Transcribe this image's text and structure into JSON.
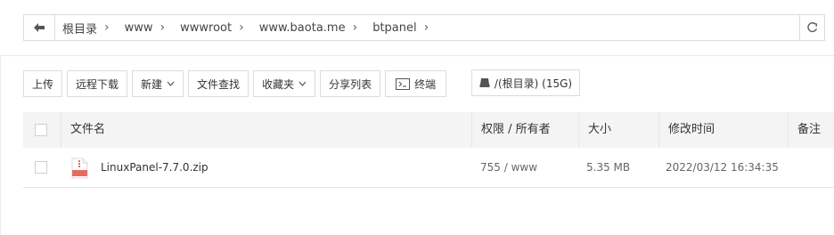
{
  "breadcrumb": {
    "items": [
      "根目录",
      "www",
      "wwwroot",
      "www.baota.me",
      "btpanel"
    ]
  },
  "toolbar": {
    "upload": "上传",
    "remote_download": "远程下载",
    "new": "新建",
    "file_search": "文件查找",
    "favorites": "收藏夹",
    "share_list": "分享列表",
    "terminal": "终端",
    "disk": "/(根目录) (15G)"
  },
  "table": {
    "headers": {
      "filename": "文件名",
      "permission": "权限 / 所有者",
      "size": "大小",
      "modified": "修改时间",
      "note": "备注"
    },
    "rows": [
      {
        "name": "LinuxPanel-7.7.0.zip",
        "permission": "755 / www",
        "size": "5.35 MB",
        "modified": "2022/03/12 16:34:35",
        "note": ""
      }
    ]
  },
  "icons": {
    "back": "arrow-left-icon",
    "refresh": "refresh-icon",
    "terminal": "terminal-icon",
    "disk": "disk-icon",
    "chevron": "chevron-down-icon",
    "zip": "zip-file-icon"
  },
  "colors": {
    "zip_icon": "#e56b5f",
    "border": "#dcdcdc",
    "header_bg": "#f4f4f4"
  }
}
